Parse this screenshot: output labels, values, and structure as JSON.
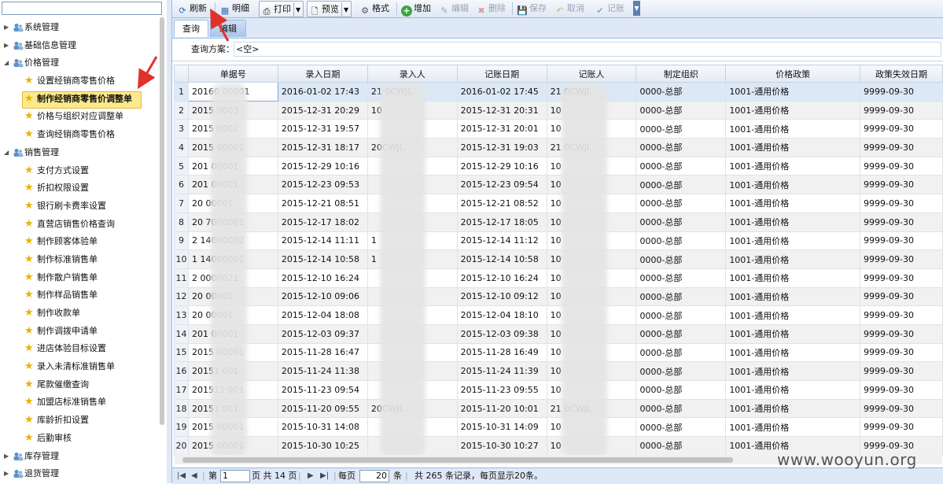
{
  "tree": [
    {
      "label": "系统管理",
      "type": "folder",
      "expanded": false
    },
    {
      "label": "基础信息管理",
      "type": "folder",
      "expanded": false
    },
    {
      "label": "价格管理",
      "type": "folder",
      "expanded": true
    },
    {
      "label": "设置经销商零售价格",
      "type": "leaf"
    },
    {
      "label": "制作经销商零售价调整单",
      "type": "leaf",
      "selected": true
    },
    {
      "label": "价格与组织对应调整单",
      "type": "leaf"
    },
    {
      "label": "查询经销商零售价格",
      "type": "leaf"
    },
    {
      "label": "销售管理",
      "type": "folder",
      "expanded": true
    },
    {
      "label": "支付方式设置",
      "type": "leaf"
    },
    {
      "label": "折扣权限设置",
      "type": "leaf"
    },
    {
      "label": "银行刷卡费率设置",
      "type": "leaf"
    },
    {
      "label": "直营店销售价格查询",
      "type": "leaf"
    },
    {
      "label": "制作顾客体验单",
      "type": "leaf"
    },
    {
      "label": "制作标准销售单",
      "type": "leaf"
    },
    {
      "label": "制作散户销售单",
      "type": "leaf"
    },
    {
      "label": "制作样品销售单",
      "type": "leaf"
    },
    {
      "label": "制作收款单",
      "type": "leaf"
    },
    {
      "label": "制作调拨申请单",
      "type": "leaf"
    },
    {
      "label": "进店体验目标设置",
      "type": "leaf"
    },
    {
      "label": "录入未清标准销售单",
      "type": "leaf"
    },
    {
      "label": "尾款催缴查询",
      "type": "leaf"
    },
    {
      "label": "加盟店标准销售单",
      "type": "leaf"
    },
    {
      "label": "库龄折扣设置",
      "type": "leaf"
    },
    {
      "label": "后勤审核",
      "type": "leaf"
    },
    {
      "label": "库存管理",
      "type": "folder",
      "expanded": false
    },
    {
      "label": "退货管理",
      "type": "folder",
      "expanded": false
    }
  ],
  "toolbar": {
    "refresh": "刷新",
    "detail": "明细",
    "print": "打印",
    "preview": "预览",
    "format": "格式",
    "add": "增加",
    "edit": "编辑",
    "delete": "删除",
    "save": "保存",
    "cancel": "取消",
    "post": "记账"
  },
  "tabs": {
    "query": "查询",
    "edit": "编辑"
  },
  "query": {
    "label": "查询方案：",
    "value": "<空>"
  },
  "grid": {
    "columns": [
      "单据号",
      "录入日期",
      "录入人",
      "记账日期",
      "记账人",
      "制定组织",
      "价格政策",
      "政策失效日期"
    ],
    "rows": [
      [
        "1",
        "20160  00001",
        "2016-01-02 17:43",
        "21    0CWJL",
        "2016-01-02 17:45",
        "21   0CWJL",
        "0000-总部",
        "1001-通用价格",
        "9999-09-30"
      ],
      [
        "2",
        "2015  0003",
        "2015-12-31 20:29",
        "10",
        "2015-12-31 20:31",
        "10",
        "0000-总部",
        "1001-通用价格",
        "9999-09-30"
      ],
      [
        "3",
        "2015  0002",
        "2015-12-31 19:57",
        "",
        "2015-12-31 20:01",
        "10",
        "0000-总部",
        "1001-通用价格",
        "9999-09-30"
      ],
      [
        "4",
        "2015  00001",
        "2015-12-31 18:17",
        "20CWJL",
        "2015-12-31 19:03",
        "21   0CWJL",
        "0000-总部",
        "1001-通用价格",
        "9999-09-30"
      ],
      [
        "5",
        "201  00001",
        "2015-12-29 10:16",
        "",
        "2015-12-29 10:16",
        "10",
        "0000-总部",
        "1001-通用价格",
        "9999-09-30"
      ],
      [
        "6",
        "201  00001",
        "2015-12-23 09:53",
        "",
        "2015-12-23 09:54",
        "10",
        "0000-总部",
        "1001-通用价格",
        "9999-09-30"
      ],
      [
        "7",
        "20  00001",
        "2015-12-21 08:51",
        "",
        "2015-12-21 08:52",
        "10",
        "0000-总部",
        "1001-通用价格",
        "9999-09-30"
      ],
      [
        "8",
        "20  7000001",
        "2015-12-17 18:02",
        "",
        "2015-12-17 18:05",
        "10",
        "0000-总部",
        "1001-通用价格",
        "9999-09-30"
      ],
      [
        "9",
        "2  14000002",
        "2015-12-14 11:11",
        "1",
        "2015-12-14 11:12",
        "10",
        "0000-总部",
        "1001-通用价格",
        "9999-09-30"
      ],
      [
        "10",
        "1  14000001",
        "2015-12-14 10:58",
        "1",
        "2015-12-14 10:58",
        "10",
        "0000-总部",
        "1001-通用价格",
        "9999-09-30"
      ],
      [
        "11",
        "2  0000021",
        "2015-12-10 16:24",
        "",
        "2015-12-10 16:24",
        "10",
        "0000-总部",
        "1001-通用价格",
        "9999-09-30"
      ],
      [
        "12",
        "20  00001",
        "2015-12-10 09:06",
        "",
        "2015-12-10 09:12",
        "10",
        "0000-总部",
        "1001-通用价格",
        "9999-09-30"
      ],
      [
        "13",
        "20  00001",
        "2015-12-04 18:08",
        "",
        "2015-12-04 18:10",
        "10",
        "0000-总部",
        "1001-通用价格",
        "9999-09-30"
      ],
      [
        "14",
        "201  00001",
        "2015-12-03 09:37",
        "",
        "2015-12-03 09:38",
        "10",
        "0000-总部",
        "1001-通用价格",
        "9999-09-30"
      ],
      [
        "15",
        "2015  00001",
        "2015-11-28 16:47",
        "",
        "2015-11-28 16:49",
        "10",
        "0000-总部",
        "1001-通用价格",
        "9999-09-30"
      ],
      [
        "16",
        "20151  001",
        "2015-11-24 11:38",
        "",
        "2015-11-24 11:39",
        "10",
        "0000-总部",
        "1001-通用价格",
        "9999-09-30"
      ],
      [
        "17",
        "201511  001",
        "2015-11-23 09:54",
        "",
        "2015-11-23 09:55",
        "10",
        "0000-总部",
        "1001-通用价格",
        "9999-09-30"
      ],
      [
        "18",
        "20151  001",
        "2015-11-20 09:55",
        "20CWJL",
        "2015-11-20 10:01",
        "21   0CWJL",
        "0000-总部",
        "1001-通用价格",
        "9999-09-30"
      ],
      [
        "19",
        "2015  00001",
        "2015-10-31 14:08",
        "",
        "2015-10-31 14:09",
        "10",
        "0000-总部",
        "1001-通用价格",
        "9999-09-30"
      ],
      [
        "20",
        "2015  00001",
        "2015-10-30 10:25",
        "",
        "2015-10-30 10:27",
        "10",
        "0000-总部",
        "1001-通用价格",
        "9999-09-30"
      ]
    ]
  },
  "pager": {
    "page_prefix": "第",
    "page_value": "1",
    "page_of": "页 共 14 页",
    "per_page_prefix": "每页",
    "per_page_value": "20",
    "per_page_suffix": "条",
    "summary": "共 265 条记录，每页显示20条。"
  },
  "watermark": "www.wooyun.org",
  "colors": {
    "accent_blue": "#99bbe8",
    "selected_bg": "#fde98d",
    "arrow_red": "#e0322a"
  }
}
